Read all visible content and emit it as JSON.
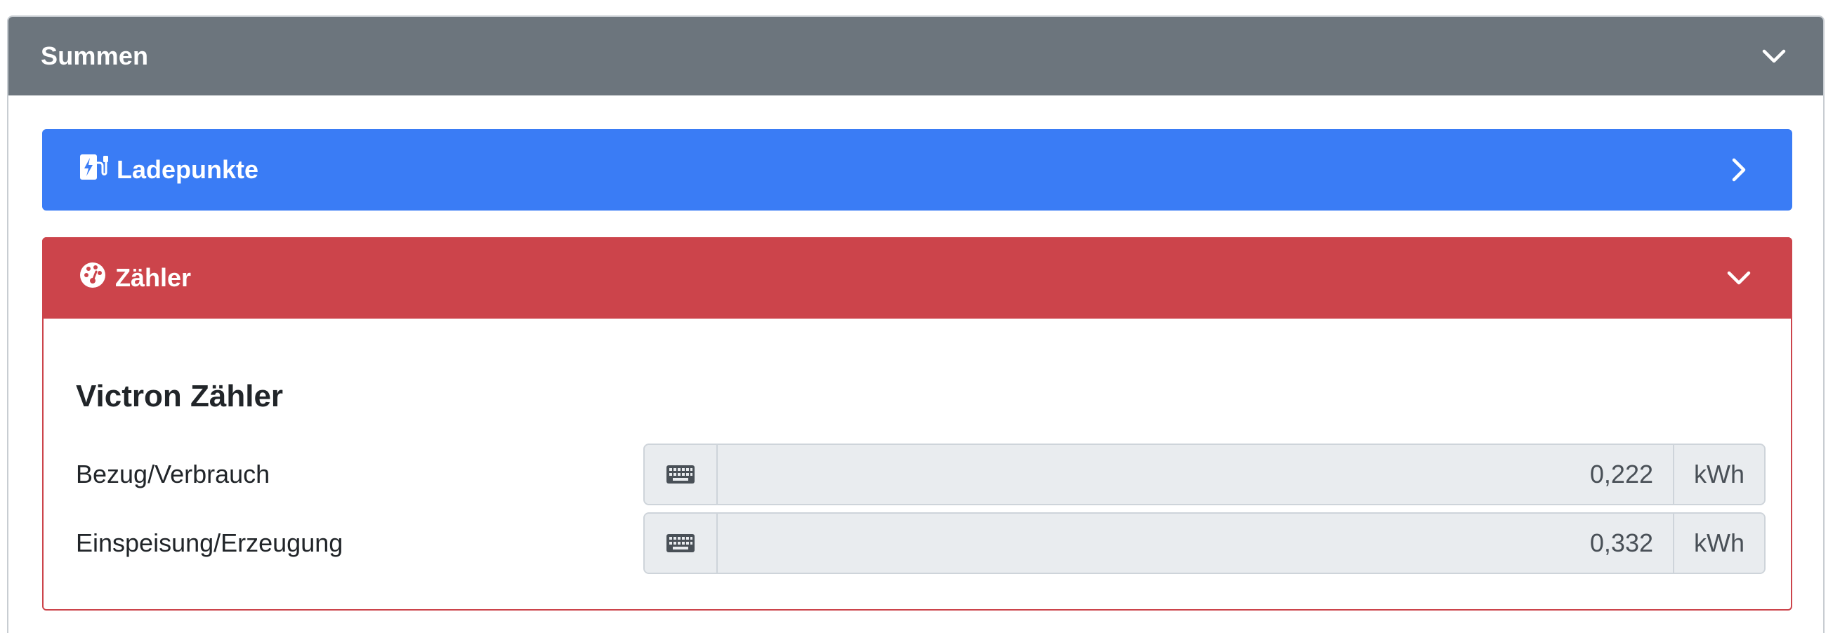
{
  "summen": {
    "title": "Summen",
    "chevron_icon": "chevron-down-icon"
  },
  "ladepunkte": {
    "title": "Ladepunkte",
    "icon": "charging-station-icon",
    "chevron_icon": "chevron-right-icon",
    "color": "#3a7cf5"
  },
  "zaehler": {
    "title": "Zähler",
    "icon": "tachometer-icon",
    "chevron_icon": "chevron-down-icon",
    "color": "#cc444b",
    "device": {
      "name": "Victron Zähler",
      "rows": [
        {
          "label": "Bezug/Verbrauch",
          "icon": "keyboard-icon",
          "value": "0,222",
          "unit": "kWh"
        },
        {
          "label": "Einspeisung/Erzeugung",
          "icon": "keyboard-icon",
          "value": "0,332",
          "unit": "kWh"
        }
      ]
    }
  },
  "colors": {
    "header_gray": "#6c757d"
  }
}
